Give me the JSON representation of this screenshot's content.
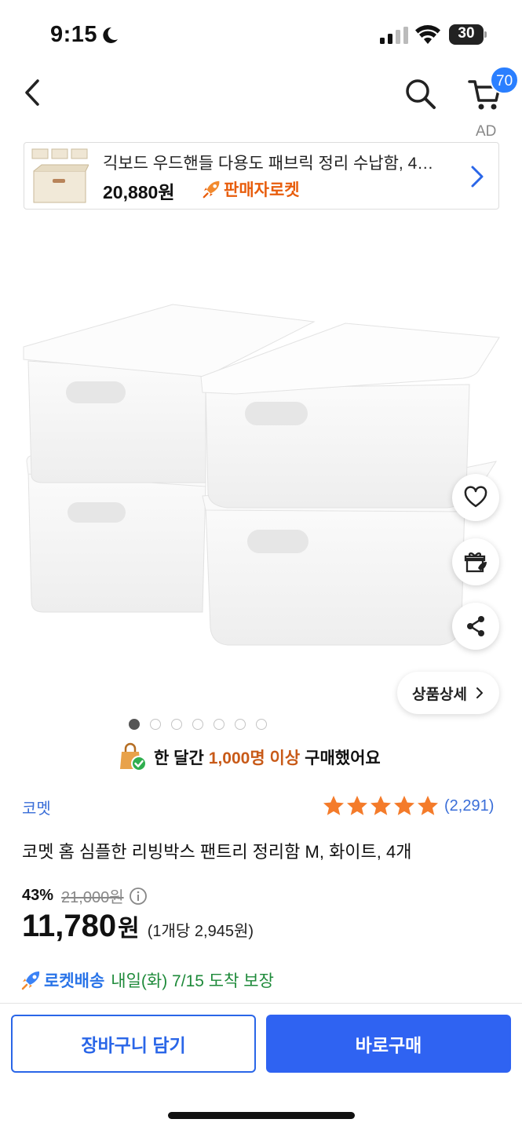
{
  "status_bar": {
    "time": "9:15",
    "battery": "30"
  },
  "nav": {
    "cart_count": "70"
  },
  "ad": {
    "label": "AD",
    "title": "긱보드 우드핸들 다용도 패브릭 정리 수납함, 4…",
    "price": "20,880원",
    "badge": "판매자로켓"
  },
  "product_actions": {
    "detail_label": "상품상세"
  },
  "gallery": {
    "total": 7,
    "active": 0
  },
  "notice": {
    "prefix": "한 달간",
    "highlight": "1,000명 이상",
    "suffix": "구매했어요"
  },
  "product": {
    "brand": "코멧",
    "rating_count": "(2,291)",
    "rating": 5,
    "title": "코멧 홈 심플한 리빙박스 팬트리 정리함 M, 화이트, 4개",
    "discount": "43%",
    "original_price": "21,000원",
    "price": "11,780",
    "price_unit": "원",
    "unit_price": "(1개당 2,945원)"
  },
  "delivery": {
    "type": "로켓배송",
    "date": "내일(화) 7/15 도착 보장"
  },
  "buttons": {
    "cart": "장바구니 담기",
    "buy": "바로구매"
  },
  "colors": {
    "accent_blue": "#2f63f2",
    "rocket_orange": "#e85d0c",
    "star": "#f47b2a"
  }
}
